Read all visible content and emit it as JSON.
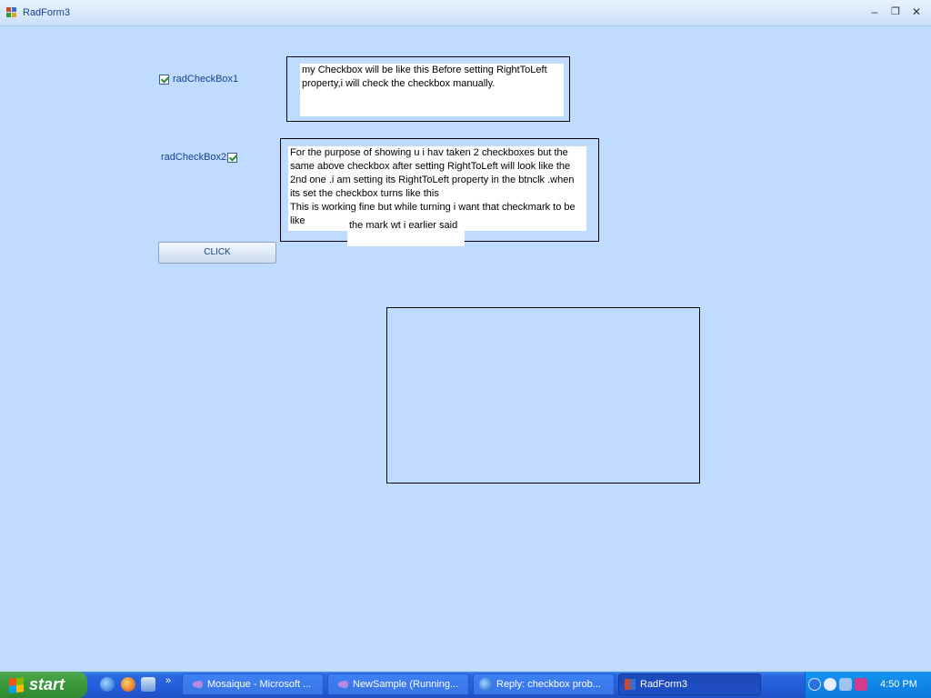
{
  "window": {
    "title": "RadForm3",
    "minimize_glyph": "–",
    "restore_glyph": "❐",
    "close_glyph": "✕"
  },
  "form": {
    "checkbox1": {
      "label": "radCheckBox1",
      "checked": true
    },
    "checkbox2": {
      "label": "radCheckBox2",
      "checked": true
    },
    "note1": "my Checkbox will be like this Before setting RightToLeft property,i will check the checkbox manually.",
    "note2_main": "For the purpose of showing u i hav taken 2 checkboxes but the same above checkbox after setting RightToLeft  will look like the 2nd one .i am setting its RightToLeft property in the btnclk .when its set the checkbox turns like this\nThis is working fine but while turning i want that checkmark to be like",
    "note2_tail": "the mark wt i earlier said",
    "click_button": "CLICK"
  },
  "taskbar": {
    "start_label": "start",
    "quick_launch_more": "»",
    "tasks": [
      {
        "label": "Mosaique - Microsoft ...",
        "icon": "visual-studio-icon",
        "active": false
      },
      {
        "label": "NewSample (Running...",
        "icon": "visual-studio-icon",
        "active": false
      },
      {
        "label": "Reply: checkbox prob...",
        "icon": "internet-explorer-icon",
        "active": false
      },
      {
        "label": "RadForm3",
        "icon": "form-icon",
        "active": true
      }
    ],
    "clock": "4:50 PM"
  }
}
